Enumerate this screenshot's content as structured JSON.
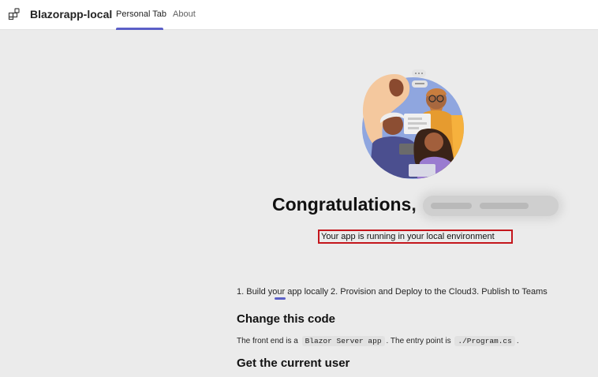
{
  "header": {
    "app_icon": "apps-grid-icon",
    "app_title": "Blazorapp-local",
    "tabs": [
      {
        "label": "Personal Tab",
        "selected": true
      },
      {
        "label": "About",
        "selected": false
      }
    ]
  },
  "hero": {
    "illustration": "people-collaborating-illustration",
    "greeting": "Congratulations,",
    "user_name_blurred": true,
    "status_message": "Your app is running in your local environment"
  },
  "steps": [
    {
      "label": "1. Build your app locally",
      "selected": true
    },
    {
      "label": "2. Provision and Deploy to the Cloud",
      "selected": false
    },
    {
      "label": "3. Publish to Teams",
      "selected": false
    }
  ],
  "content": {
    "change_code_heading": "Change this code",
    "front_end_prefix": "The front end is a",
    "front_end_code": "Blazor Server app",
    "entry_point_text": ". The entry point is",
    "entry_point_code": "./Program.cs",
    "entry_point_suffix": ".",
    "current_user_heading": "Get the current user"
  },
  "colors": {
    "accent": "#5b5fc7",
    "highlight_box": "#c4161c",
    "background": "#ebebeb"
  }
}
